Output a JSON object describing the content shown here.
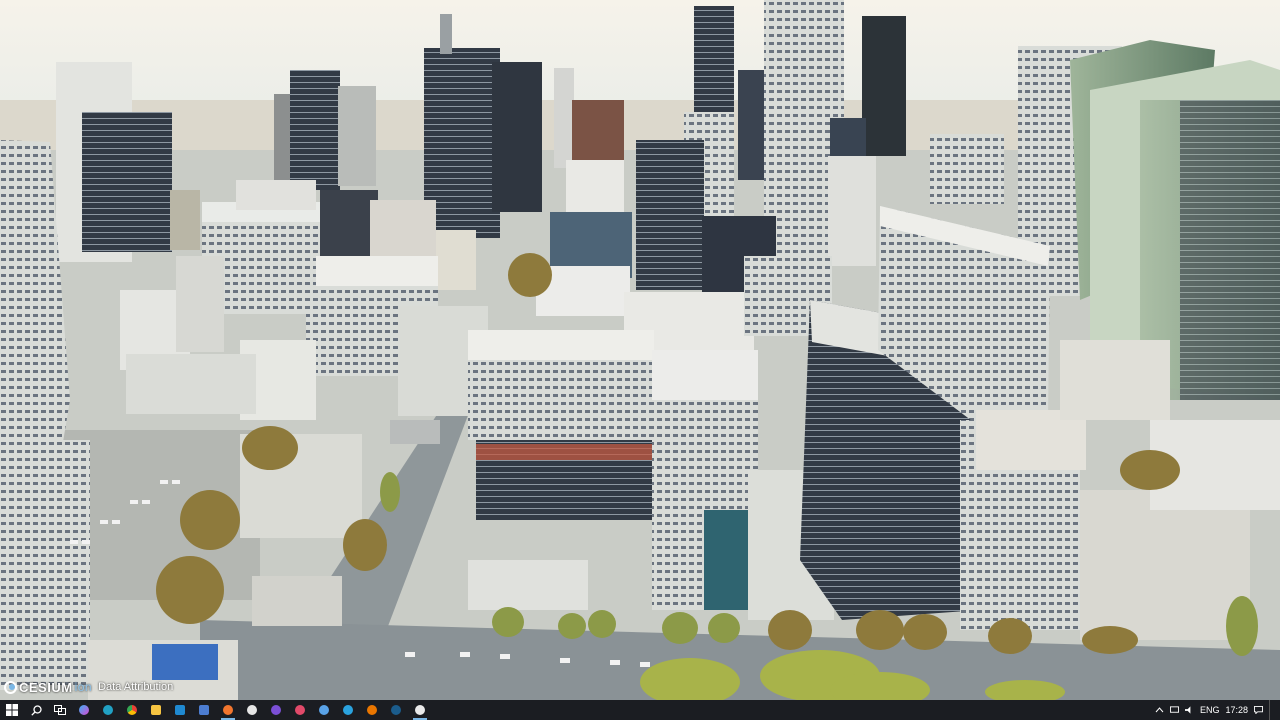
{
  "viewer": {
    "logo_text": "CESIUM",
    "logo_sub": "ion",
    "attribution_link": "Data Attribution",
    "colors": {
      "sky_top": "#f3efe4",
      "sky_bottom": "#e7ebe6",
      "ground": "#cfd2cb",
      "road": "#9da4a6",
      "tree": "#8f7a3a"
    }
  },
  "taskbar": {
    "pinned_apps": [
      "windows-start-icon",
      "search-icon",
      "task-view-icon",
      "copilot-icon",
      "edge-icon",
      "chrome-icon",
      "file-explorer-icon",
      "vscode-icon",
      "save-icon",
      "firefox-icon",
      "obs-icon",
      "app-icon",
      "app-icon",
      "app-icon",
      "telegram-icon",
      "blender-icon",
      "steam-icon",
      "unreal-engine-icon"
    ],
    "language": "ENG",
    "time": "17:28"
  }
}
